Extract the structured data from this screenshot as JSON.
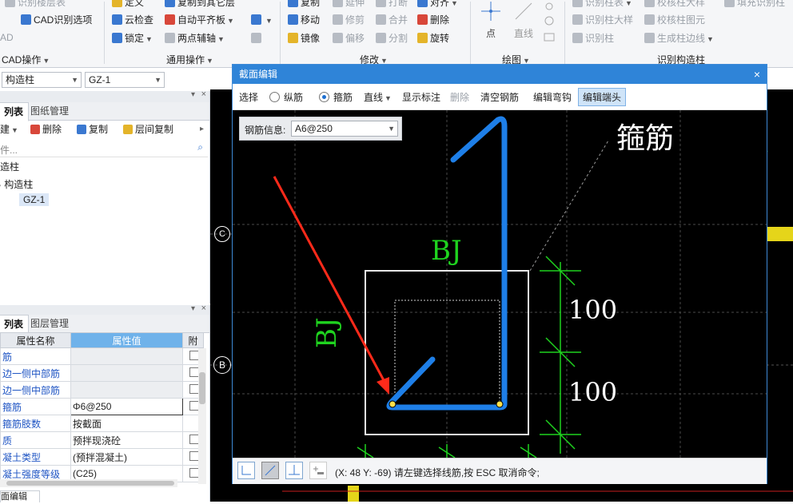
{
  "ribbon": {
    "row1": [
      "识别楼层表",
      "定义",
      "复制到其它层",
      "复制",
      "延伸",
      "打断",
      "对齐",
      "识别柱表",
      "校核柱大样",
      "填充识别柱"
    ],
    "cad_options": "CAD识别选项",
    "cloud_check": "云检查",
    "auto_flat": "自动平齐板",
    "lock": "锁定",
    "two_point_axis": "两点辅轴",
    "move": "移动",
    "trim": "修剪",
    "merge": "合并",
    "delete": "删除",
    "mirror": "镜像",
    "offset": "偏移",
    "split": "分割",
    "rotate": "旋转",
    "point": "点",
    "line": "直线",
    "identify_column_detail": "识别柱大样",
    "check_column_figure": "校核柱图元",
    "identify_column": "识别柱",
    "generate_column_edge": "生成柱边线",
    "cad_short": "AD",
    "groups": [
      "CAD操作",
      "通用操作",
      "修改",
      "绘图",
      "识别构造柱"
    ]
  },
  "combos": {
    "element_type": "构造柱",
    "element_name": "GZ-1"
  },
  "component_panel": {
    "tabs": [
      "列表",
      "图纸管理"
    ],
    "tools": [
      "建",
      "删除",
      "复制",
      "层间复制"
    ],
    "search_placeholder": "件...",
    "tree": {
      "root": "造柱",
      "group": "构造柱",
      "leaf": "GZ-1"
    }
  },
  "property_panel": {
    "tabs": [
      "列表",
      "图层管理"
    ],
    "headers": [
      "属性名称",
      "属性值",
      "附"
    ],
    "rows": [
      {
        "name": "筋",
        "value": "",
        "grey": true,
        "chk": true
      },
      {
        "name": "边一侧中部筋",
        "value": "",
        "grey": true,
        "chk": true
      },
      {
        "name": "边一侧中部筋",
        "value": "",
        "grey": true,
        "chk": true
      },
      {
        "name": "箍筋",
        "value": "Φ6@250",
        "sel": true,
        "chk": true
      },
      {
        "name": "箍筋肢数",
        "value": "按截面",
        "chk": false
      },
      {
        "name": "质",
        "value": "预拌现浇砼",
        "chk": true
      },
      {
        "name": "凝土类型",
        "value": "(预拌混凝土)",
        "chk": true
      },
      {
        "name": "凝土强度等级",
        "value": "(C25)",
        "chk": true
      }
    ]
  },
  "bottom_tab": "面编辑",
  "axis_markers": [
    "C",
    "B"
  ],
  "dialog": {
    "title": "截面编辑",
    "close": "×",
    "toolbar": {
      "select": "选择",
      "longitudinal": "纵筋",
      "stirrup": "箍筋",
      "line": "直线",
      "show_annotation": "显示标注",
      "delete": "删除",
      "clear_rebar": "清空钢筋",
      "edit_hook": "编辑弯钩",
      "edit_end": "编辑端头"
    },
    "rebar_info_label": "钢筋信息:",
    "rebar_info_value": "A6@250",
    "canvas": {
      "label_bj_top": "BJ",
      "label_bj_left": "BJ",
      "dim_upper": "100",
      "dim_lower": "100",
      "stirrup_label": "箍筋"
    },
    "status": "(X: 48 Y: -69) 请左键选择线筋,按 ESC 取消命令;"
  },
  "colors": {
    "title_bar": "#2f84d8",
    "rebar": "#1e7fe8",
    "dimension": "#1fd31f",
    "arrow": "#ff2a1a"
  }
}
